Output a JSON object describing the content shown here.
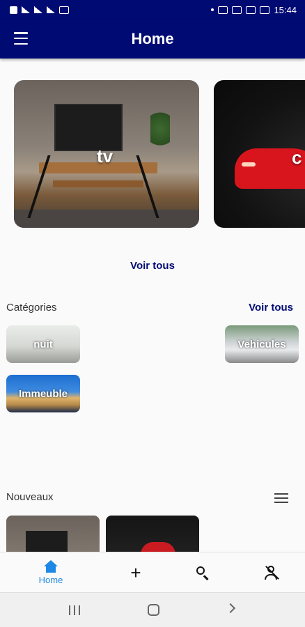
{
  "status_bar": {
    "time": "15:44"
  },
  "app_bar": {
    "title": "Home"
  },
  "carousel": {
    "items": [
      {
        "label": "tv"
      },
      {
        "label": "c"
      }
    ],
    "see_all": "Voir tous"
  },
  "categories": {
    "title": "Catégories",
    "see_all": "Voir tous",
    "items": [
      {
        "label": "nuit"
      },
      {
        "label": "Vehicules"
      },
      {
        "label": "Immeuble"
      }
    ]
  },
  "nouveaux": {
    "title": "Nouveaux"
  },
  "bottom_nav": {
    "home_label": "Home"
  },
  "colors": {
    "primary": "#000a73",
    "active_nav": "#1e88e5"
  },
  "icons": [
    "menu-icon",
    "list-icon",
    "home-icon",
    "add-icon",
    "search-icon",
    "user-off-icon"
  ]
}
